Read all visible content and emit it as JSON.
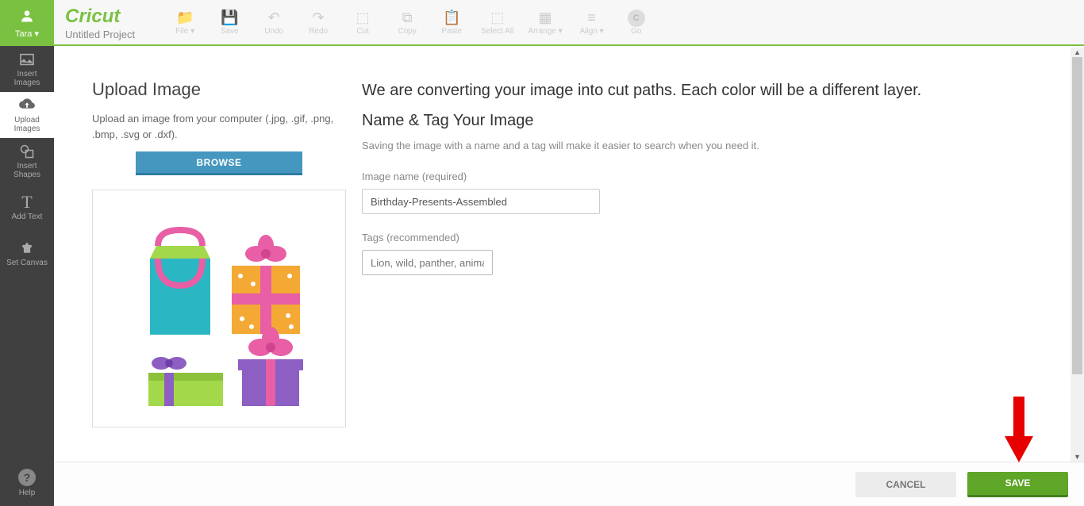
{
  "user": {
    "name": "Tara"
  },
  "brand": {
    "logo": "Cricut",
    "project": "Untitled Project"
  },
  "toolbar": [
    {
      "label": "File ▾",
      "icon": "folder"
    },
    {
      "label": "Save",
      "icon": "floppy"
    },
    {
      "label": "Undo",
      "icon": "undo"
    },
    {
      "label": "Redo",
      "icon": "redo"
    },
    {
      "label": "Cut",
      "icon": "cut"
    },
    {
      "label": "Copy",
      "icon": "copy"
    },
    {
      "label": "Paste",
      "icon": "paste"
    },
    {
      "label": "Select All",
      "icon": "selectall"
    },
    {
      "label": "Arrange ▾",
      "icon": "arrange"
    },
    {
      "label": "Align ▾",
      "icon": "align"
    },
    {
      "label": "Go",
      "icon": "go"
    }
  ],
  "sidebar": {
    "items": [
      {
        "label": "Insert\nImages",
        "icon": "image"
      },
      {
        "label": "Upload\nImages",
        "icon": "upload"
      },
      {
        "label": "Insert\nShapes",
        "icon": "shapes"
      },
      {
        "label": "Add Text",
        "icon": "text"
      },
      {
        "label": "Set Canvas",
        "icon": "canvas"
      }
    ],
    "help": "Help"
  },
  "upload_panel": {
    "title": "Upload Image",
    "desc": "Upload an image from your computer (.jpg, .gif, .png, .bmp, .svg or .dxf).",
    "browse": "BROWSE"
  },
  "form": {
    "heading1": "We are converting your image into cut paths. Each color will be a different layer.",
    "heading2": "Name & Tag Your Image",
    "subtext": "Saving the image with a name and a tag will make it easier to search when you need it.",
    "name_label": "Image name (required)",
    "name_value": "Birthday-Presents-Assembled",
    "tags_label": "Tags (recommended)",
    "tags_placeholder": "Lion, wild, panther, anima"
  },
  "bottom": {
    "cancel": "CANCEL",
    "save": "SAVE"
  }
}
